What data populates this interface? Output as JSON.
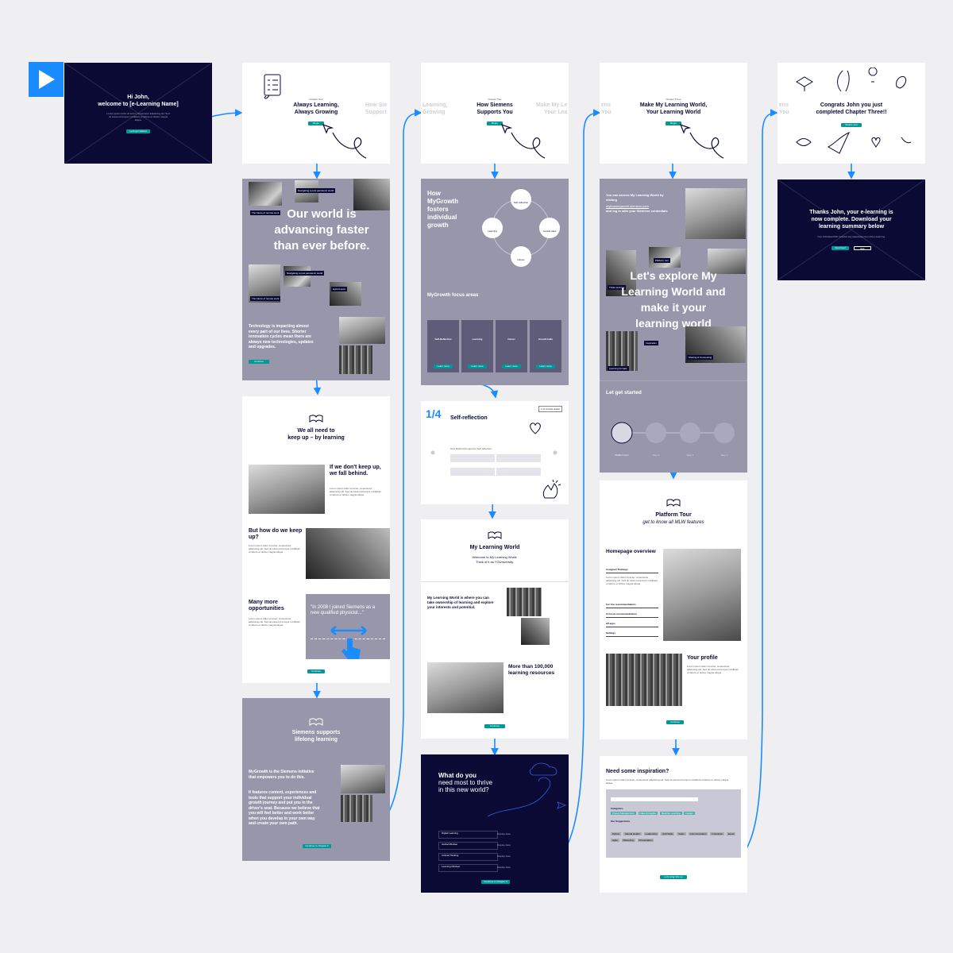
{
  "intro": {
    "greeting_line1": "Hi John,",
    "greeting_line2": "welcome to [e-Learning Name]",
    "body": "Lorem ipsum dolor sit amet, consectetur adipiscing elit. Sed do eiusmod tempor incididunt ut labore et dolore magna aliqua.",
    "button": "Let's get started"
  },
  "ch1": {
    "overline": "Chapter One",
    "title_line1": "Always Learning,",
    "title_line2": "Always Growing",
    "ghost_line1": "How Sie",
    "ghost_line2": "Support",
    "button": "Begin",
    "hero_line1": "Our world is",
    "hero_line2": "advancing faster",
    "hero_line3": "than ever before.",
    "labels": [
      "The future of remote work",
      "Navigating a post pandemic world",
      "The future of remote work",
      "Navigating a post pandemic world",
      "Hybrid work"
    ],
    "impact_text": "Technology is impacting almost every part of our lives. Shorter innovation cycles mean there are always new technologies, updates and upgrades.",
    "continue": "Continue",
    "keepup_title_line1": "We all need to",
    "keepup_title_line2": "keep up – by learning",
    "fallbehind": "If we don't keep up, we fall behind.",
    "howkeep": "But how do we keep up?",
    "many": "Many more opportunities",
    "quote": "\"In 2008 I joined Siemens as a new qualified physicist...\"",
    "lorem": "Lorem ipsum dolor sit amet, consectetur adipiscing elit. Sed do eiusmod tempor incididunt ut labore et dolore magna aliqua.",
    "continue2": "Continue",
    "supports_line1": "Siemens supports",
    "supports_line2": "lifelong learning",
    "mygrowth_text": "MyGrowth is the Siemens initiative that empowers you to do this.",
    "features_text": "It features content, experiences and tools that support your individual growth journey and put you in the driver's seat. Because we believe that you will feel better and work better when you develop in your own way and create your own path.",
    "next_button": "Continue to Chapter 2"
  },
  "ch2": {
    "overline": "Chapter Two",
    "title_line1": "How Siemens",
    "title_line2": "Supports You",
    "ghost_left_line1": "Learning,",
    "ghost_left_line2": "Growing",
    "ghost_right_line1": "Make My Le",
    "ghost_right_line2": "Your Lea",
    "button": "Begin",
    "fosters_line1": "How",
    "fosters_line2": "MyGrowth",
    "fosters_line3": "fosters",
    "fosters_line4": "individual",
    "fosters_line5": "growth",
    "cycle": [
      "Self-reflection",
      "Learning",
      "Growth talks",
      "Career"
    ],
    "focus_title": "MyGrowth focus areas",
    "focus_cards": [
      {
        "title": "Self-Reflection",
        "button": "Learn more"
      },
      {
        "title": "Learning",
        "button": "Learn more"
      },
      {
        "title": "Career",
        "button": "Learn more"
      },
      {
        "title": "Growth talks",
        "button": "Learn more"
      }
    ],
    "step": "1/4",
    "step_title": "Self-reflection",
    "step_tag": "1 of 4 focus areas",
    "support_label": "How MyGrowth supports Self-reflection",
    "mlw_title": "My Learning World",
    "mlw_sub_line1": "Welcome to My Learning World:",
    "mlw_sub_line2": "Think of it as YOUniversity.",
    "mlw_text": "My Learning World is where you can take ownership of learning and explore your interests and potential.",
    "resources": "More than 100,000 learning resources",
    "continue": "Continue",
    "thrive_line1": "What do you",
    "thrive_line2": "need most to thrive",
    "thrive_line3": "in this new world?",
    "rows": [
      "Digital Learning",
      "Global Mindset",
      "Critical Thinking",
      "Learning Mindset"
    ],
    "rows_right": [
      "Display data",
      "Display data",
      "Display data",
      "Display data"
    ],
    "next_button": "Continue to Chapter 3"
  },
  "ch3": {
    "overline": "Chapter Three",
    "title_line1": "Make My Learning World,",
    "title_line2": "Your Learning World",
    "ghost_line1": "ens",
    "ghost_line2": "You",
    "button": "Begin",
    "access_text": "You can access My Learning World by visiting",
    "access_link": "mylearningworld.siemens.com",
    "access_text2": "and log in with your Siemens credentials",
    "hero_line1": "Let's explore My",
    "hero_line2": "Learning World and",
    "hero_line3": "make it your",
    "hero_line4": "learning world",
    "labels": [
      "Tricks and tips",
      "Platform tour",
      "Inspiration",
      "Sharing & Connecting",
      "Learning formats"
    ],
    "get_started": "Let get started",
    "steps": [
      "Platform tour",
      "Step 2",
      "Step 3",
      "Step 4"
    ],
    "tour_title": "Platform Tour",
    "tour_sub": "get to know all MLW features",
    "homepage": "Homepage overview",
    "menu": [
      "Assigned Trainings",
      "For You recommendations",
      "In Focus recommendations",
      "All apps",
      "Settings"
    ],
    "profile": "Your profile",
    "continue": "Continue",
    "inspiration": "Need some inspiration?",
    "cats_title": "Categories",
    "cats_title2": "Our Suggestions",
    "tags1": [
      "Project Management",
      "Data & Insights",
      "Machine Learning",
      "Design"
    ],
    "tags2": [
      "Python",
      "Mental Health",
      "Leadership",
      "Soft Skills",
      "Sales",
      "Communication",
      "Innovation",
      "Excel",
      "Agile",
      "Marketing",
      "Presentation"
    ],
    "done_button": "Let's wrap this up"
  },
  "congrats": {
    "title_line1": "Congrats John you just",
    "title_line2": "completed Chapter Three!!",
    "ghost_line1": "ens",
    "ghost_line2": "You",
    "button": "What's next",
    "end_line1": "Thanks John, your e-learning is",
    "end_line2": "now complete. Download your",
    "end_line3": "learning summary below",
    "end_body": "Your individual PDF includes key takeaways from this e-learning.",
    "download": "Download",
    "exit": "Exit"
  },
  "colors": {
    "teal": "#009999",
    "navy": "#0a0a35",
    "grey": "#9896ab",
    "arrow": "#1a8cff"
  }
}
